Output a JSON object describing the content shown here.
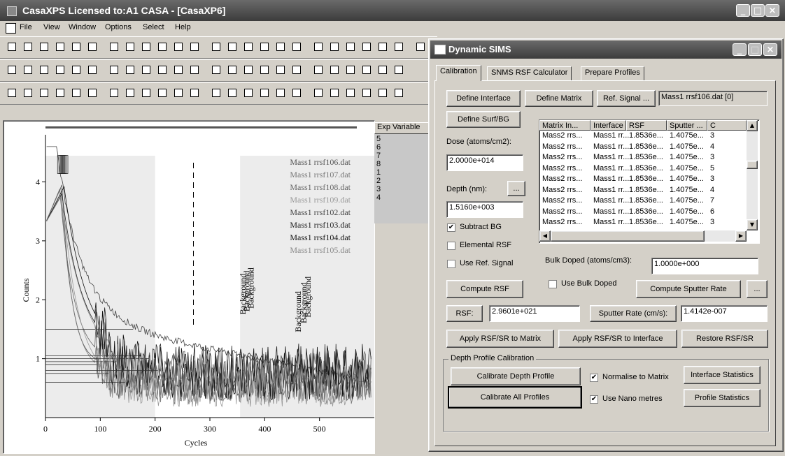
{
  "main_window": {
    "title": "CasaXPS Licensed to:A1 CASA - [CasaXP6]",
    "menu": [
      "File",
      "View",
      "Window",
      "Options",
      "Select",
      "Help"
    ]
  },
  "plot": {
    "legend": [
      "Mass1 rrsf106.dat",
      "Mass1 rrsf107.dat",
      "Mass1 rrsf108.dat",
      "Mass1 rrsf109.dat",
      "Mass1 rrsf102.dat",
      "Mass1 rrsf103.dat",
      "Mass1 rrsf104.dat",
      "Mass1 rrsf105.dat"
    ],
    "background_label": "Background"
  },
  "chart_data": {
    "type": "line",
    "xlabel": "Cycles",
    "ylabel": "Counts",
    "x_ticks": [
      0,
      100,
      200,
      300,
      400,
      500
    ],
    "y_ticks": [
      1,
      2,
      3,
      4
    ],
    "xlim": [
      0,
      600
    ],
    "ylim": [
      0,
      4.8
    ],
    "log_scale": false,
    "grid": false,
    "series": [
      {
        "name": "Mass1 rrsf106.dat",
        "color": "#555555",
        "peak_x": 30,
        "peak_y": 3.95,
        "background": 0.9
      },
      {
        "name": "Mass1 rrsf107.dat",
        "color": "#777777",
        "peak_x": 28,
        "peak_y": 3.9,
        "background": 0.75
      },
      {
        "name": "Mass1 rrsf108.dat",
        "color": "#666666",
        "peak_x": 26,
        "peak_y": 3.88,
        "background": 0.95
      },
      {
        "name": "Mass1 rrsf109.dat",
        "color": "#999999",
        "peak_x": 30,
        "peak_y": 3.85,
        "background": 0.6
      },
      {
        "name": "Mass1 rrsf102.dat",
        "color": "#444444",
        "peak_x": 32,
        "peak_y": 3.9,
        "background": 1.5
      },
      {
        "name": "Mass1 rrsf103.dat",
        "color": "#222222",
        "peak_x": 30,
        "peak_y": 3.8,
        "background": 1.05
      },
      {
        "name": "Mass1 rrsf104.dat",
        "color": "#111111",
        "peak_x": 34,
        "peak_y": 3.92,
        "background": 1.0
      },
      {
        "name": "Mass1 rrsf105.dat",
        "color": "#888888",
        "peak_x": 28,
        "peak_y": 3.75,
        "background": 0.8
      }
    ],
    "cursor_x": 270,
    "highlight_ranges": [
      [
        0,
        200
      ],
      [
        355,
        600
      ]
    ]
  },
  "exp_panel": {
    "header": "Exp Variable",
    "rows": [
      "5",
      "6",
      "7",
      "8",
      "1",
      "2",
      "3",
      "4"
    ]
  },
  "dialog": {
    "title": "Dynamic SIMS",
    "tabs": [
      "Calibration",
      "SNMS RSF Calculator",
      "Prepare Profiles"
    ],
    "define_interface": "Define Interface",
    "define_matrix": "Define Matrix",
    "ref_signal": "Ref. Signal ...",
    "ref_signal_value": "Mass1 rrsf106.dat [0]",
    "define_surf_bg": "Define Surf/BG",
    "dose_label": "Dose (atoms/cm2):",
    "dose_value": "2.0000e+014",
    "depth_label": "Depth (nm):",
    "depth_browse": "...",
    "depth_value": "1.5160e+003",
    "subtract_bg": "Subtract BG",
    "elemental_rsf": "Elemental RSF",
    "use_ref_signal": "Use Ref. Signal",
    "table": {
      "columns": [
        "Matrix In...",
        "Interface",
        "RSF",
        "Sputter ...",
        "C"
      ],
      "rows": [
        [
          "Mass2 rrs...",
          "Mass1 rr...",
          "1.8536e...",
          "1.4075e...",
          "3"
        ],
        [
          "Mass2 rrs...",
          "Mass1 rr...",
          "1.8536e...",
          "1.4075e...",
          "4"
        ],
        [
          "Mass2 rrs...",
          "Mass1 rr...",
          "1.8536e...",
          "1.4075e...",
          "3"
        ],
        [
          "Mass2 rrs...",
          "Mass1 rr...",
          "1.8536e...",
          "1.4075e...",
          "5"
        ],
        [
          "Mass2 rrs...",
          "Mass1 rr...",
          "1.8536e...",
          "1.4075e...",
          "3"
        ],
        [
          "Mass2 rrs...",
          "Mass1 rr...",
          "1.8536e...",
          "1.4075e...",
          "4"
        ],
        [
          "Mass2 rrs...",
          "Mass1 rr...",
          "1.8536e...",
          "1.4075e...",
          "7"
        ],
        [
          "Mass2 rrs...",
          "Mass1 rr...",
          "1.8536e...",
          "1.4075e...",
          "6"
        ],
        [
          "Mass2 rrs...",
          "Mass1 rr...",
          "1.8536e...",
          "1.4075e...",
          "3"
        ]
      ]
    },
    "bulk_doped_label": "Bulk Doped (atoms/cm3):",
    "bulk_doped_value": "1.0000e+000",
    "compute_rsf": "Compute RSF",
    "use_bulk_doped": "Use Bulk Doped",
    "compute_sputter_rate": "Compute Sputter Rate",
    "extra_button": "...",
    "rsf_button": "RSF:",
    "rsf_value": "2.9601e+021",
    "sputter_rate_button": "Sputter Rate (cm/s):",
    "sputter_rate_value": "1.4142e-007",
    "apply_matrix": "Apply RSF/SR to Matrix",
    "apply_interface": "Apply RSF/SR to Interface",
    "restore": "Restore RSF/SR",
    "group_label": "Depth Profile Calibration",
    "calibrate_depth": "Calibrate Depth Profile",
    "calibrate_all": "Calibrate All Profiles",
    "normalise": "Normalise to Matrix",
    "use_nano": "Use Nano metres",
    "interface_stats": "Interface Statistics",
    "profile_stats": "Profile Statistics"
  }
}
